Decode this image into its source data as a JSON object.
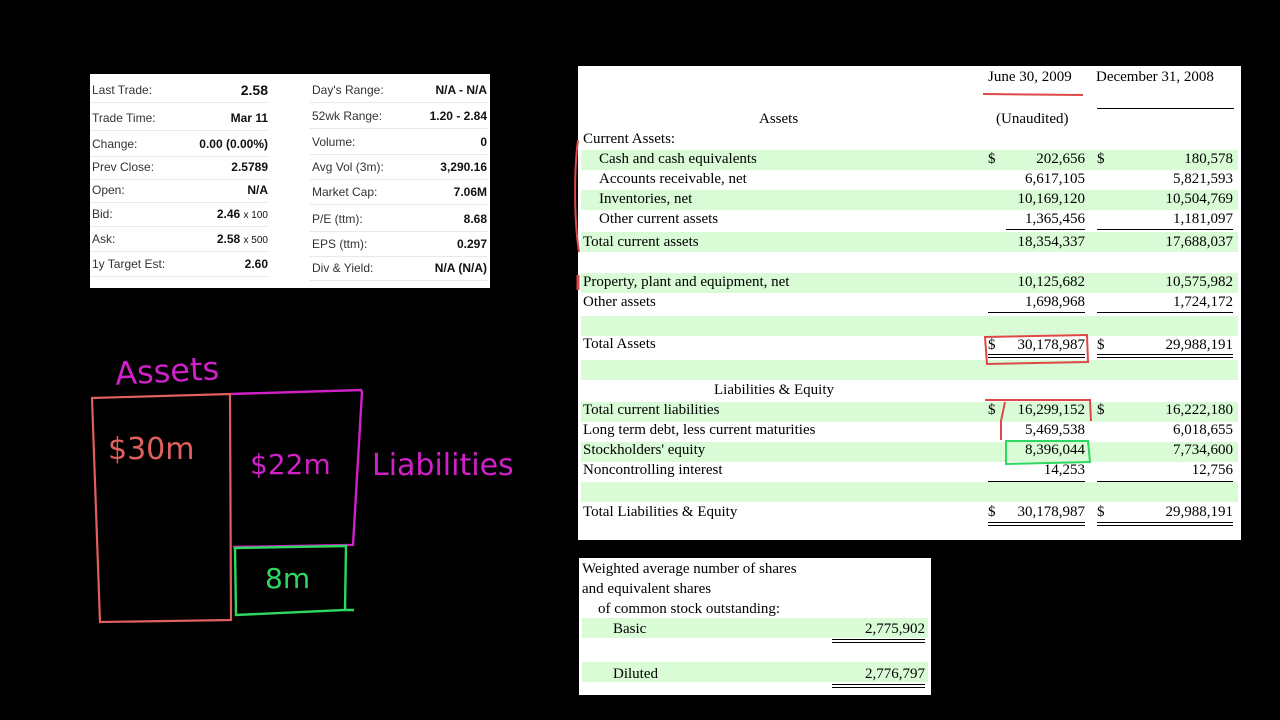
{
  "quote": {
    "left": [
      {
        "k": "Last Trade:",
        "v": "2.58"
      },
      {
        "k": "Trade Time:",
        "v": "Mar 11"
      },
      {
        "k": "Change:",
        "v": "0.00 (0.00%)"
      },
      {
        "k": "Prev Close:",
        "v": "2.5789"
      },
      {
        "k": "Open:",
        "v": "N/A"
      },
      {
        "k": "Bid:",
        "v": "2.46",
        "x": "x 100"
      },
      {
        "k": "Ask:",
        "v": "2.58",
        "x": "x 500"
      },
      {
        "k": "1y Target Est:",
        "v": "2.60"
      }
    ],
    "right": [
      {
        "k": "Day's Range:",
        "v": "N/A - N/A"
      },
      {
        "k": "52wk Range:",
        "v": "1.20 - 2.84"
      },
      {
        "k": "Volume:",
        "v": "0"
      },
      {
        "k": "Avg Vol (3m):",
        "v": "3,290.16"
      },
      {
        "k": "Market Cap:",
        "v": "7.06M"
      },
      {
        "k": "P/E (ttm):",
        "v": "8.68"
      },
      {
        "k": "EPS (ttm):",
        "v": "0.297"
      },
      {
        "k": "Div & Yield:",
        "v": "N/A (N/A)"
      }
    ]
  },
  "balance_sheet": {
    "col1_header": "June 30, 2009",
    "col2_header": "December 31, 2008",
    "col1_sub": "(Unaudited)",
    "assets_heading": "Assets",
    "current_assets_label": "Current Assets:",
    "dollar": "$",
    "rows": [
      {
        "label": "Cash and cash equivalents",
        "v1": "202,656",
        "v2": "180,578"
      },
      {
        "label": "Accounts receivable, net",
        "v1": "6,617,105",
        "v2": "5,821,593"
      },
      {
        "label": "Inventories, net",
        "v1": "10,169,120",
        "v2": "10,504,769"
      },
      {
        "label": "Other current assets",
        "v1": "1,365,456",
        "v2": "1,181,097"
      },
      {
        "label": "Total current assets",
        "v1": "18,354,337",
        "v2": "17,688,037"
      },
      {
        "label": "Property, plant and equipment, net",
        "v1": "10,125,682",
        "v2": "10,575,982"
      },
      {
        "label": "Other assets",
        "v1": "1,698,968",
        "v2": "1,724,172"
      },
      {
        "label": "Total Assets",
        "v1": "30,178,987",
        "v2": "29,988,191"
      },
      {
        "label": "Total current liabilities",
        "v1": "16,299,152",
        "v2": "16,222,180"
      },
      {
        "label": "Long term debt, less current maturities",
        "v1": "5,469,538",
        "v2": "6,018,655"
      },
      {
        "label": "Stockholders' equity",
        "v1": "8,396,044",
        "v2": "7,734,600"
      },
      {
        "label": "Noncontrolling interest",
        "v1": "14,253",
        "v2": "12,756"
      },
      {
        "label": "Total Liabilities & Equity",
        "v1": "30,178,987",
        "v2": "29,988,191"
      }
    ],
    "liab_heading": "Liabilities & Equity"
  },
  "shares": {
    "line1": "Weighted average number of shares",
    "line2": "and equivalent shares",
    "line3": "of common stock outstanding:",
    "basic_label": "Basic",
    "basic_value": "2,775,902",
    "diluted_label": "Diluted",
    "diluted_value": "2,776,797"
  },
  "sketch": {
    "assets_label": "Assets",
    "assets_value": "$30m",
    "liab_value": "$22m",
    "liab_label": "Liabilities",
    "equity_value": "8m",
    "colors": {
      "assets": "#e0605e",
      "liabilities": "#d020c8",
      "equity": "#2ed860",
      "highlight_red": "#e04848"
    }
  }
}
